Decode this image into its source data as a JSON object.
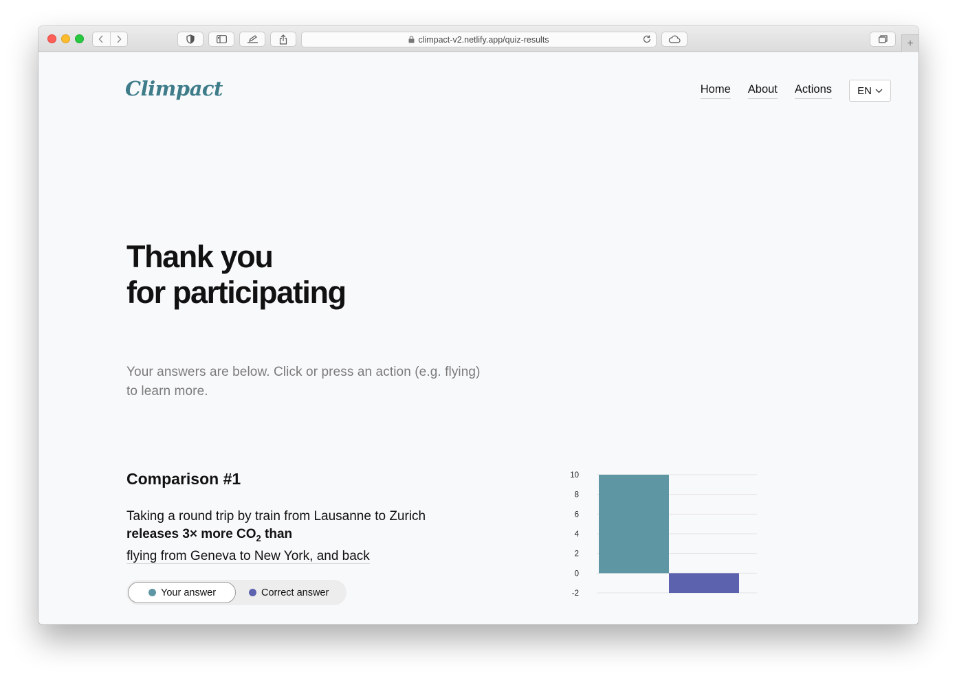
{
  "browser": {
    "url": "climpact-v2.netlify.app/quiz-results"
  },
  "header": {
    "logo": "Climpact",
    "nav": [
      "Home",
      "About",
      "Actions"
    ],
    "language": "EN"
  },
  "hero": {
    "title_line1": "Thank you",
    "title_line2": "for participating",
    "subtitle": "Your answers are below. Click or press an action (e.g. flying) to learn more."
  },
  "comparison": {
    "title": "Comparison #1",
    "line1": "Taking a round trip by train from Lausanne to Zurich",
    "line2_pre": "releases 3× more CO",
    "line2_sub": "2",
    "line2_post": " than",
    "line3": "flying from Geneva to New York, and back",
    "toggle": {
      "your_answer": "Your answer",
      "correct_answer": "Correct answer",
      "selected": "Your answer"
    }
  },
  "colors": {
    "your_answer": "#5e96a3",
    "correct_answer": "#5c62ad",
    "logo": "#3e7c89"
  },
  "chart_data": {
    "type": "bar",
    "categories": [
      "Your answer",
      "Correct answer"
    ],
    "values": [
      10,
      -2
    ],
    "ylim": [
      -2,
      10
    ],
    "yticks": [
      -2,
      0,
      2,
      4,
      6,
      8,
      10
    ],
    "grid": true
  }
}
